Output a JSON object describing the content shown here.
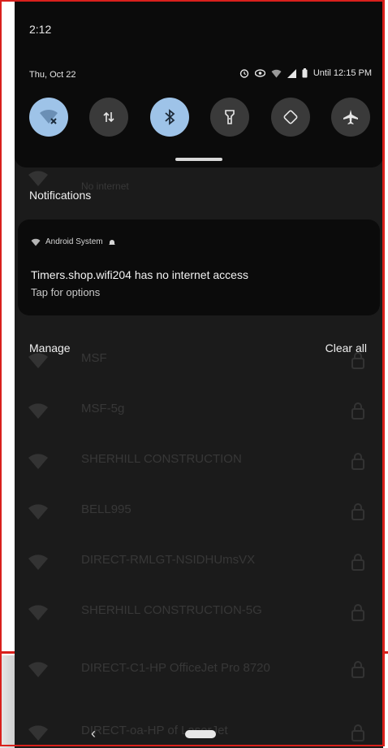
{
  "status_bar": {
    "time": "2:12"
  },
  "header": {
    "date": "Thu, Oct 22",
    "alarm_status": "Until 12:15 PM"
  },
  "quick_settings": [
    {
      "icon": "wifi-off-icon",
      "state": "on"
    },
    {
      "icon": "mobile-data-icon",
      "state": "off"
    },
    {
      "icon": "bluetooth-icon",
      "state": "on"
    },
    {
      "icon": "flashlight-icon",
      "state": "off"
    },
    {
      "icon": "auto-rotate-icon",
      "state": "off"
    },
    {
      "icon": "airplane-mode-icon",
      "state": "off"
    }
  ],
  "background_list": [
    {
      "name": "No internet"
    },
    {
      "name": "MSF"
    },
    {
      "name": "MSF-5g"
    },
    {
      "name": "SHERHILL CONSTRUCTION"
    },
    {
      "name": "BELL995"
    },
    {
      "name": "DIRECT-RMLGT-NSIDHUmsVX"
    },
    {
      "name": "SHERHILL CONSTRUCTION-5G"
    },
    {
      "name": "DIRECT-C1-HP OfficeJet Pro 8720"
    },
    {
      "name": "DIRECT-oa-HP of LaserJet"
    }
  ],
  "notifications": {
    "heading": "Notifications",
    "items": [
      {
        "app": "Android System",
        "title": "Timers.shop.wifi204 has no internet access",
        "body": "Tap for options"
      }
    ],
    "manage_label": "Manage",
    "clear_all_label": "Clear all"
  },
  "colors": {
    "tile_on": "#9ec3e8",
    "tile_off": "#3a3a3a",
    "shade": "#0b0b0b",
    "frame": "#d9201c"
  }
}
